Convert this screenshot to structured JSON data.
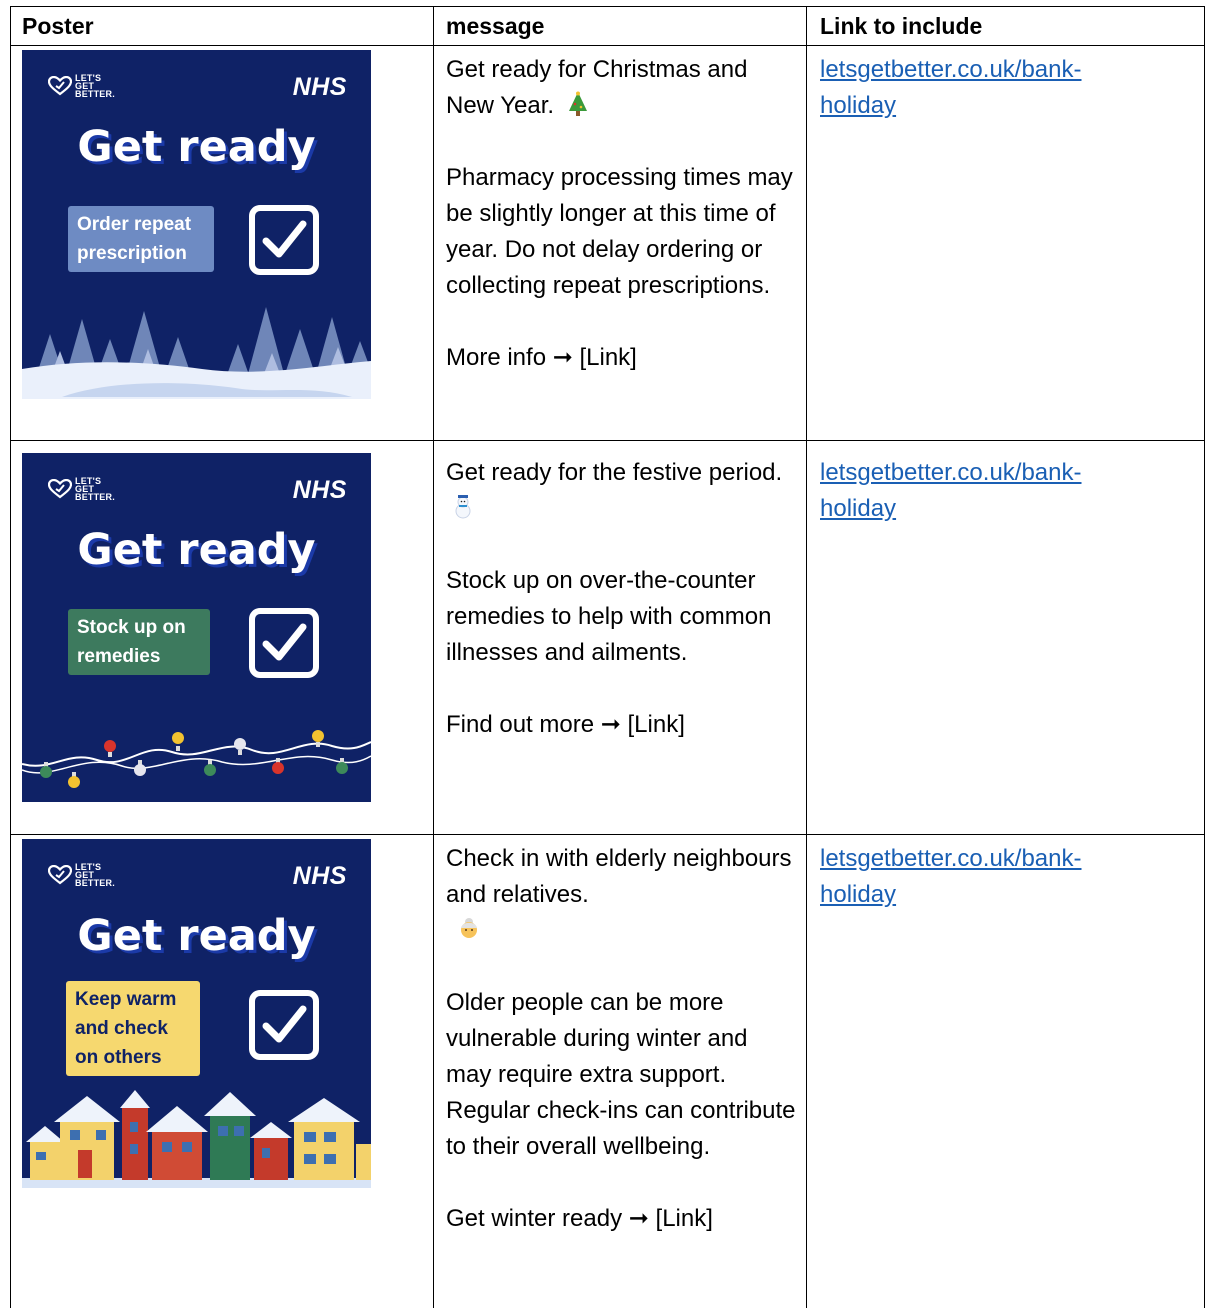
{
  "table": {
    "headers": [
      "Poster",
      "message",
      "Link to include"
    ],
    "rows": [
      {
        "poster": {
          "logo_text": "LET'S GET BETTER.",
          "brand": "NHS",
          "title": "Get ready",
          "tag": "Order repeat prescription",
          "tag_color": "#6e8bc3",
          "art": "snowy-trees-icon"
        },
        "message": {
          "headline": "Get ready for Christmas and New Year.",
          "emoji": "christmas-tree-icon",
          "body": "Pharmacy processing times may be slightly longer at this time of year. Do not delay ordering or collecting repeat prescriptions.",
          "cta": "More info ➞ [Link]"
        },
        "link": "letsgetbetter.co.uk/bank-holiday"
      },
      {
        "poster": {
          "logo_text": "LET'S GET BETTER.",
          "brand": "NHS",
          "title": "Get ready",
          "tag": "Stock up on remedies",
          "tag_color": "#3d7a5e",
          "art": "festive-lights-icon"
        },
        "message": {
          "headline": "Get ready for the festive period.",
          "emoji": "snowman-icon",
          "body": "Stock up on over-the-counter remedies to help with common illnesses and ailments.",
          "cta": "Find out more ➞ [Link]"
        },
        "link": "letsgetbetter.co.uk/bank-holiday"
      },
      {
        "poster": {
          "logo_text": "LET'S GET BETTER.",
          "brand": "NHS",
          "title": "Get ready",
          "tag": "Keep warm and check on others",
          "tag_color": "#f6d86f",
          "art": "snowy-houses-icon"
        },
        "message": {
          "headline": "Check in with elderly neighbours and relatives.",
          "emoji": "older-woman-icon",
          "body": "Older people can be more vulnerable during winter and may require extra support. Regular check-ins can contribute to their overall wellbeing.",
          "cta": "Get winter ready ➞ [Link]"
        },
        "link": "letsgetbetter.co.uk/bank-holiday"
      }
    ]
  },
  "colors": {
    "poster_bg": "#0f2266",
    "link": "#1a5fb4",
    "border": "#000000"
  }
}
